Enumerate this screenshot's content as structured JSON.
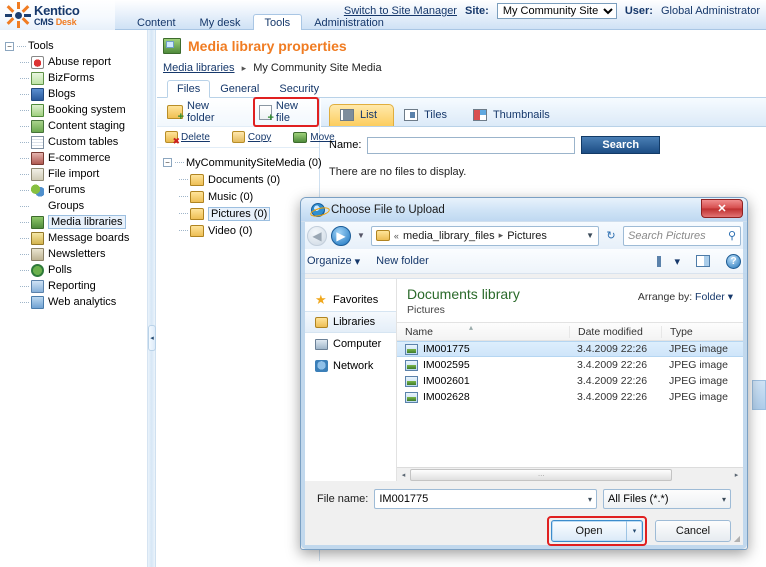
{
  "header": {
    "logo_line1": "Kentico",
    "logo_line2_cms": "CMS ",
    "logo_line2_desk": "Desk",
    "nav": [
      {
        "label": "Content",
        "active": false
      },
      {
        "label": "My desk",
        "active": false
      },
      {
        "label": "Tools",
        "active": true
      },
      {
        "label": "Administration",
        "active": false
      }
    ],
    "switch_link": "Switch to Site Manager",
    "site_label": "Site:",
    "site_value": "My Community Site",
    "user_label": "User:",
    "user_value": "Global Administrator"
  },
  "sidebar": {
    "root": "Tools",
    "items": [
      {
        "label": "Abuse report",
        "icon": "abuse-report-icon",
        "selected": false
      },
      {
        "label": "BizForms",
        "icon": "bizforms-icon",
        "selected": false
      },
      {
        "label": "Blogs",
        "icon": "blogs-icon",
        "selected": false
      },
      {
        "label": "Booking system",
        "icon": "booking-system-icon",
        "selected": false
      },
      {
        "label": "Content staging",
        "icon": "content-staging-icon",
        "selected": false
      },
      {
        "label": "Custom tables",
        "icon": "custom-tables-icon",
        "selected": false
      },
      {
        "label": "E-commerce",
        "icon": "ecommerce-icon",
        "selected": false
      },
      {
        "label": "File import",
        "icon": "file-import-icon",
        "selected": false
      },
      {
        "label": "Forums",
        "icon": "forums-icon",
        "selected": false
      },
      {
        "label": "Groups",
        "icon": "groups-icon",
        "selected": false
      },
      {
        "label": "Media libraries",
        "icon": "media-libraries-icon",
        "selected": true
      },
      {
        "label": "Message boards",
        "icon": "message-boards-icon",
        "selected": false
      },
      {
        "label": "Newsletters",
        "icon": "newsletters-icon",
        "selected": false
      },
      {
        "label": "Polls",
        "icon": "polls-icon",
        "selected": false
      },
      {
        "label": "Reporting",
        "icon": "reporting-icon",
        "selected": false
      },
      {
        "label": "Web analytics",
        "icon": "web-analytics-icon",
        "selected": false
      }
    ]
  },
  "main": {
    "page_title": "Media library properties",
    "breadcrumb_link": "Media libraries",
    "breadcrumb_sep": "▸",
    "breadcrumb_current": "My Community Site Media",
    "tabs": [
      {
        "label": "Files",
        "active": true
      },
      {
        "label": "General",
        "active": false
      },
      {
        "label": "Security",
        "active": false
      }
    ],
    "commands": {
      "new_folder": "New folder",
      "new_file": "New file"
    },
    "actions": {
      "delete": "Delete",
      "copy": "Copy",
      "move": "Move"
    },
    "folder_tree": [
      {
        "label": "MyCommunitySiteMedia (0)",
        "level": 1,
        "selected": false
      },
      {
        "label": "Documents (0)",
        "level": 2,
        "selected": false
      },
      {
        "label": "Music (0)",
        "level": 2,
        "selected": false
      },
      {
        "label": "Pictures (0)",
        "level": 2,
        "selected": true
      },
      {
        "label": "Video (0)",
        "level": 2,
        "selected": false
      }
    ],
    "views": [
      {
        "label": "List",
        "icon": "list-view-icon",
        "active": true
      },
      {
        "label": "Tiles",
        "icon": "tiles-view-icon",
        "active": false
      },
      {
        "label": "Thumbnails",
        "icon": "thumbnails-view-icon",
        "active": false
      }
    ],
    "search": {
      "label": "Name:",
      "value": "",
      "placeholder": "",
      "button": "Search"
    },
    "empty_message": "There are no files to display."
  },
  "dialog": {
    "title": "Choose File to Upload",
    "close_label": "✕",
    "address": {
      "chev": "«",
      "crumb1": "media_library_files",
      "sep": "▸",
      "crumb2": "Pictures",
      "dropdown": "▼",
      "refresh": "↻"
    },
    "search_placeholder": "Search Pictures",
    "search_icon": "⚲",
    "toolbar": {
      "organize": "Organize",
      "organize_caret": "▾",
      "new_folder": "New folder",
      "views_caret": "▾",
      "help": "?"
    },
    "nav_items": [
      {
        "label": "Favorites",
        "icon": "favorites-star-icon",
        "selected": false
      },
      {
        "label": "Libraries",
        "icon": "libraries-folder-icon",
        "selected": true
      },
      {
        "label": "Computer",
        "icon": "computer-icon",
        "selected": false
      },
      {
        "label": "Network",
        "icon": "network-icon",
        "selected": false
      }
    ],
    "library_heading": "Documents library",
    "library_subheading": "Pictures",
    "arrange_label": "Arrange by:",
    "arrange_value": "Folder",
    "arrange_caret": "▾",
    "columns": [
      "Name",
      "Date modified",
      "Type"
    ],
    "sort_indicator": "▴",
    "files": [
      {
        "name": "IM001775",
        "date": "3.4.2009 22:26",
        "type": "JPEG image",
        "selected": true
      },
      {
        "name": "IM002595",
        "date": "3.4.2009 22:26",
        "type": "JPEG image",
        "selected": false
      },
      {
        "name": "IM002601",
        "date": "3.4.2009 22:26",
        "type": "JPEG image",
        "selected": false
      },
      {
        "name": "IM002628",
        "date": "3.4.2009 22:26",
        "type": "JPEG image",
        "selected": false
      }
    ],
    "scroll_left": "◂",
    "scroll_right": "▸",
    "scroll_grip": "…",
    "footer": {
      "filename_label": "File name:",
      "filename_value": "IM001775",
      "filename_caret": "▾",
      "filter_value": "All Files (*.*)",
      "filter_caret": "▾",
      "open_label": "Open",
      "open_caret": "▾",
      "cancel_label": "Cancel"
    }
  },
  "colors": {
    "accent_orange": "#f07c22",
    "brand_blue": "#16386b",
    "highlight_red": "#e02020",
    "active_tab_gold": "#fccd5f",
    "selection_blue": "#cfe5fa"
  }
}
